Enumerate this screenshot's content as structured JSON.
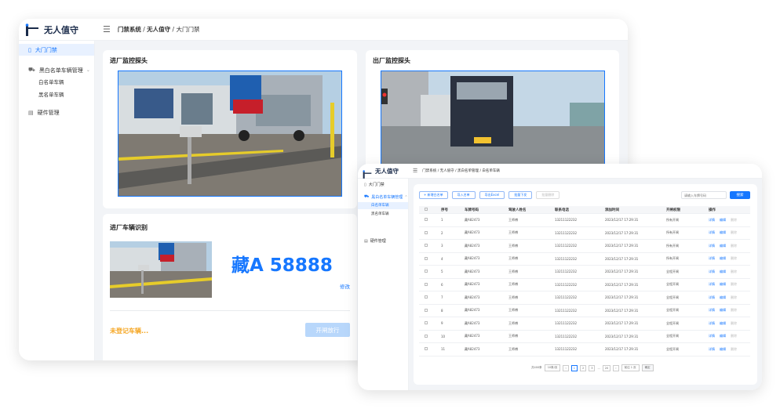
{
  "app": {
    "name": "无人值守"
  },
  "win1": {
    "breadcrumb": {
      "part1": "门禁系统",
      "sep1": " / ",
      "part2": "无人值守",
      "sep2": " / ",
      "current": "大门门禁"
    },
    "sidebar": {
      "items": [
        {
          "label": "大门门禁",
          "active": true
        },
        {
          "label": "黑白名单车辆管理"
        },
        {
          "label": "白名单车辆"
        },
        {
          "label": "黑名单车辆"
        },
        {
          "label": "硬件管理"
        }
      ]
    },
    "entry_camera": {
      "title": "进厂监控探头"
    },
    "exit_camera": {
      "title": "出厂监控探头"
    },
    "recognition": {
      "title": "进厂车辆识别",
      "plate": "藏A 58888",
      "edit_link": "修改",
      "status": "未登记车辆...",
      "open_button": "开闸放行"
    }
  },
  "win2": {
    "breadcrumb": "门禁系统 / 无人值守 / 黑白名单管理 / 白名单车辆",
    "sidebar": {
      "items": [
        {
          "label": "大门门禁"
        },
        {
          "label": "黑白名单车辆管理",
          "active": true
        },
        {
          "label": "白名单车辆",
          "active": true
        },
        {
          "label": "黑名单车辆"
        },
        {
          "label": "硬件管理"
        }
      ]
    },
    "toolbar": {
      "add": "+ 新增白名单",
      "import": "导入名单",
      "export": "导出Excel",
      "batch": "批量下发",
      "delete": "批量删除",
      "search_placeholder": "请输入车牌号码",
      "search_btn": "搜索"
    },
    "table": {
      "headers": [
        "序号",
        "车牌号码",
        "驾驶人姓名",
        "联系电话",
        "添加时间",
        "开闸权限",
        "操作"
      ],
      "actions": [
        "详情",
        "编辑",
        "删除"
      ],
      "rows": [
        [
          "1",
          "藏A82473",
          "王师傅",
          "13211122232",
          "2023/12/17  17:29:31",
          "所有开闸"
        ],
        [
          "2",
          "藏A82473",
          "王师傅",
          "13211122232",
          "2023/12/17  17:29:31",
          "所有开闸"
        ],
        [
          "3",
          "藏A82473",
          "王师傅",
          "13211122232",
          "2023/12/17  17:29:31",
          "所有开闸"
        ],
        [
          "4",
          "藏A82473",
          "王师傅",
          "13211122232",
          "2023/12/17  17:29:31",
          "所有开闸"
        ],
        [
          "5",
          "藏A82473",
          "王师傅",
          "13211122232",
          "2023/12/17  17:29:31",
          "全程开闸"
        ],
        [
          "6",
          "藏A82473",
          "王师傅",
          "13211122232",
          "2023/12/17  17:29:31",
          "全程开闸"
        ],
        [
          "7",
          "藏A82473",
          "王师傅",
          "13211122232",
          "2023/12/17  17:29:31",
          "全程开闸"
        ],
        [
          "8",
          "藏A82473",
          "王师傅",
          "13211122232",
          "2023/12/17  17:29:31",
          "全程开闸"
        ],
        [
          "9",
          "藏A82473",
          "王师傅",
          "13211122232",
          "2023/12/17  17:29:31",
          "全程开闸"
        ],
        [
          "10",
          "藏A82473",
          "王师傅",
          "13211122232",
          "2023/12/17  17:29:31",
          "全程开闸"
        ],
        [
          "11",
          "藏A82473",
          "王师傅",
          "13211122232",
          "2023/12/17  17:29:31",
          "全程开闸"
        ]
      ]
    },
    "pagination": {
      "total": "共400条",
      "page_size": "10条/页",
      "pages": [
        "1",
        "2",
        "3",
        "...",
        "20"
      ],
      "jump": "前往 1 页",
      "confirm": "确定"
    }
  }
}
